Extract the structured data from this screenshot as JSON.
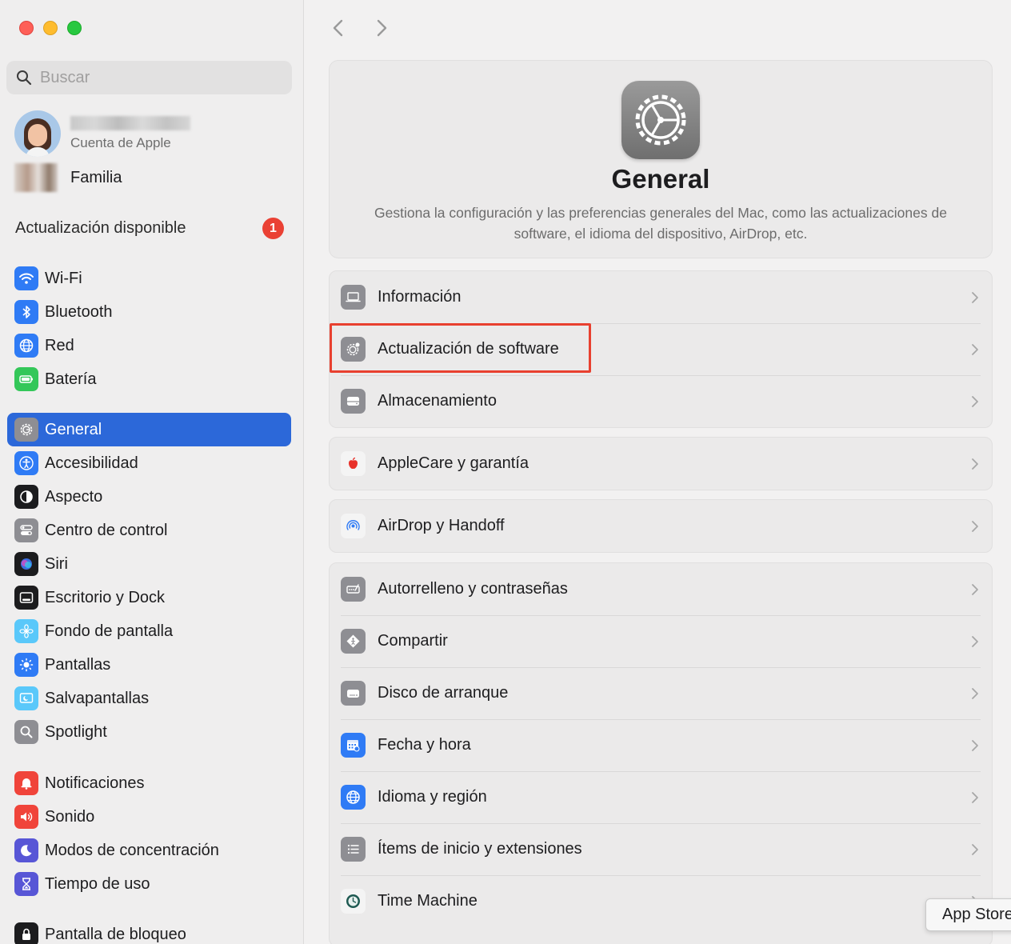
{
  "window": {
    "title": "General"
  },
  "search": {
    "placeholder": "Buscar"
  },
  "account": {
    "subtitle": "Cuenta de Apple"
  },
  "family": {
    "label": "Familia"
  },
  "update": {
    "label": "Actualización disponible",
    "count": "1"
  },
  "sidebar": {
    "group1": [
      {
        "label": "Wi-Fi",
        "icon": "wifi-icon",
        "color": "#2f7bf5"
      },
      {
        "label": "Bluetooth",
        "icon": "bluetooth-icon",
        "color": "#2f7bf5"
      },
      {
        "label": "Red",
        "icon": "globe-icon",
        "color": "#2f7bf5"
      },
      {
        "label": "Batería",
        "icon": "battery-icon",
        "color": "#34c759"
      }
    ],
    "group2": [
      {
        "label": "General",
        "icon": "gear-icon",
        "color": "#8e8e93",
        "active": true
      },
      {
        "label": "Accesibilidad",
        "icon": "accessibility-icon",
        "color": "#2f7bf5"
      },
      {
        "label": "Aspecto",
        "icon": "appearance-icon",
        "color": "#1c1c1e"
      },
      {
        "label": "Centro de control",
        "icon": "control-center-icon",
        "color": "#8e8e93"
      },
      {
        "label": "Siri",
        "icon": "siri-icon",
        "color": "#1c1c1e"
      },
      {
        "label": "Escritorio y Dock",
        "icon": "dock-icon",
        "color": "#1c1c1e"
      },
      {
        "label": "Fondo de pantalla",
        "icon": "wallpaper-icon",
        "color": "#5ac8fa"
      },
      {
        "label": "Pantallas",
        "icon": "sun-icon",
        "color": "#2f7bf5"
      },
      {
        "label": "Salvapantallas",
        "icon": "screensaver-icon",
        "color": "#5ac8fa"
      },
      {
        "label": "Spotlight",
        "icon": "magnifier-icon",
        "color": "#8e8e93"
      }
    ],
    "group3": [
      {
        "label": "Notificaciones",
        "icon": "bell-icon",
        "color": "#f0443a"
      },
      {
        "label": "Sonido",
        "icon": "speaker-icon",
        "color": "#f0443a"
      },
      {
        "label": "Modos de concentración",
        "icon": "moon-icon",
        "color": "#5856d6"
      },
      {
        "label": "Tiempo de uso",
        "icon": "hourglass-icon",
        "color": "#5856d6"
      }
    ],
    "group4": [
      {
        "label": "Pantalla de bloqueo",
        "icon": "lock-icon",
        "color": "#1c1c1e"
      }
    ]
  },
  "header": {
    "title": "General",
    "description": "Gestiona la configuración y las preferencias generales del Mac, como las actualizaciones de software, el idioma del dispositivo, AirDrop, etc."
  },
  "groups": [
    {
      "rows": [
        {
          "label": "Información",
          "icon": "laptop-icon"
        },
        {
          "label": "Actualización de software",
          "icon": "gear-badge-icon"
        },
        {
          "label": "Almacenamiento",
          "icon": "drive-icon"
        }
      ]
    },
    {
      "rows": [
        {
          "label": "AppleCare y garantía",
          "icon": "apple-logo-icon"
        }
      ]
    },
    {
      "rows": [
        {
          "label": "AirDrop y Handoff",
          "icon": "airdrop-icon"
        }
      ]
    },
    {
      "rows": [
        {
          "label": "Autorrelleno y contraseñas",
          "icon": "autofill-icon"
        },
        {
          "label": "Compartir",
          "icon": "share-icon"
        },
        {
          "label": "Disco de arranque",
          "icon": "disk-icon"
        },
        {
          "label": "Fecha y hora",
          "icon": "calendar-icon"
        },
        {
          "label": "Idioma y región",
          "icon": "globe-icon"
        },
        {
          "label": "Ítems de inicio y extensiones",
          "icon": "list-icon"
        },
        {
          "label": "Time Machine",
          "icon": "time-machine-icon"
        }
      ]
    }
  ],
  "tooltip": {
    "label": "App Store"
  },
  "colors": {
    "accent": "#2c68d9",
    "highlight": "#e8402f",
    "badge": "#ea4134"
  }
}
